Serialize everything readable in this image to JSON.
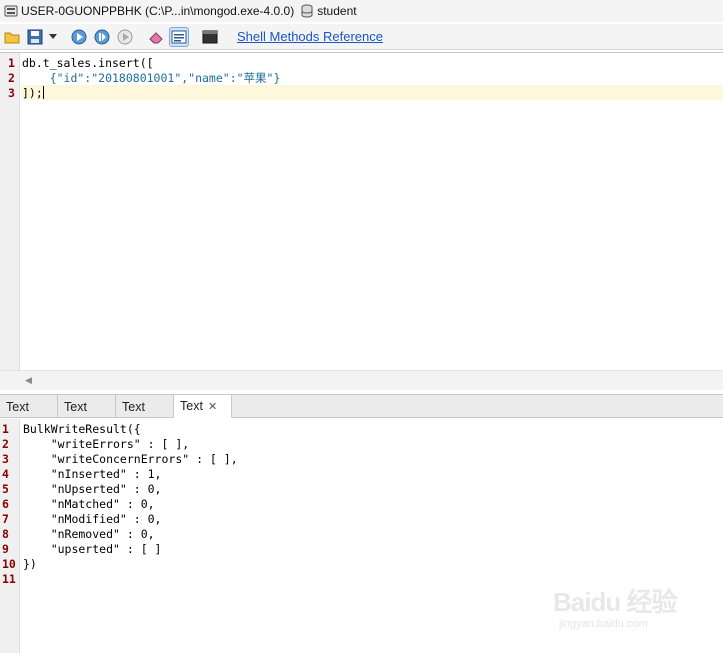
{
  "window": {
    "title": "USER-0GUONPPBHK (C:\\P...in\\mongod.exe-4.0.0)",
    "database": "student"
  },
  "toolbar": {
    "link_label": "Shell Methods Reference",
    "icons": [
      "open-folder-icon",
      "save-icon",
      "dropdown-icon",
      "run-icon",
      "run-line-icon",
      "stop-icon",
      "eraser-icon",
      "text-view-icon",
      "terminal-icon"
    ]
  },
  "editor": {
    "line_numbers": [
      "1",
      "2",
      "3"
    ],
    "lines": [
      "db.t_sales.insert([",
      "    {\"id\":\"20180801001\",\"name\":\"苹果\"}",
      "]);"
    ]
  },
  "tabs": [
    {
      "label": "Text"
    },
    {
      "label": "Text"
    },
    {
      "label": "Text"
    },
    {
      "label": "Text",
      "active": true
    }
  ],
  "results": {
    "line_numbers": [
      "1",
      "2",
      "3",
      "4",
      "5",
      "6",
      "7",
      "8",
      "9",
      "10",
      "11"
    ],
    "lines": [
      "BulkWriteResult({",
      "    \"writeErrors\" : [ ],",
      "    \"writeConcernErrors\" : [ ],",
      "    \"nInserted\" : 1,",
      "    \"nUpserted\" : 0,",
      "    \"nMatched\" : 0,",
      "    \"nModified\" : 0,",
      "    \"nRemoved\" : 0,",
      "    \"upserted\" : [ ]",
      "})",
      ""
    ]
  },
  "watermark": {
    "main": "Baidu 经验",
    "sub": "jingyan.baidu.com"
  },
  "colors": {
    "line_number": "#8b0000",
    "string": "#1b6f9a",
    "link": "#1a55c8",
    "current_line": "#fdf7dc"
  }
}
